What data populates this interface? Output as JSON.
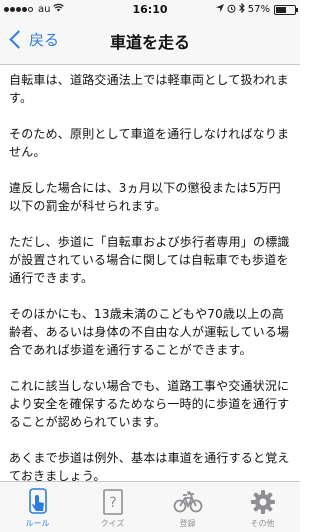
{
  "status_bar": {
    "carrier": "au",
    "time": "16:10",
    "battery_percent": "57%",
    "battery_level": 0.57
  },
  "nav": {
    "back_label": "戻る",
    "title": "車道を走る"
  },
  "content": {
    "paragraphs": [
      "自転車は、道路交通法上では軽車両として扱われます。",
      "そのため、原則として車道を通行しなければなりません。",
      "違反した場合には、3ヵ月以下の懲役または5万円以下の罰金が科せられます。",
      "ただし、歩道に「自転車および歩行者専用」の標識が設置されている場合に関しては自転車でも歩道を通行できます。",
      "そのほかにも、13歳未満のこどもや70歳以上の高齢者、あるいは身体の不自由な人が運転している場合であれば歩道を通行することができます。",
      "これに該当しない場合でも、道路工事や交通状況により安全を確保するためなら一時的に歩道を通行することが認められています。",
      "あくまで歩道は例外、基本は車道を通行すると覚えておきましょう。"
    ]
  },
  "tabs": [
    {
      "label": "ルール",
      "icon": "hand-pointer-icon",
      "active": true
    },
    {
      "label": "クイズ",
      "icon": "quiz-card-icon",
      "active": false
    },
    {
      "label": "登録",
      "icon": "bicycle-icon",
      "active": false
    },
    {
      "label": "その他",
      "icon": "gear-icon",
      "active": false
    }
  ],
  "colors": {
    "accent": "#2a7de1",
    "inactive": "#8e8e93",
    "bar_background": "#f7f7f7"
  }
}
